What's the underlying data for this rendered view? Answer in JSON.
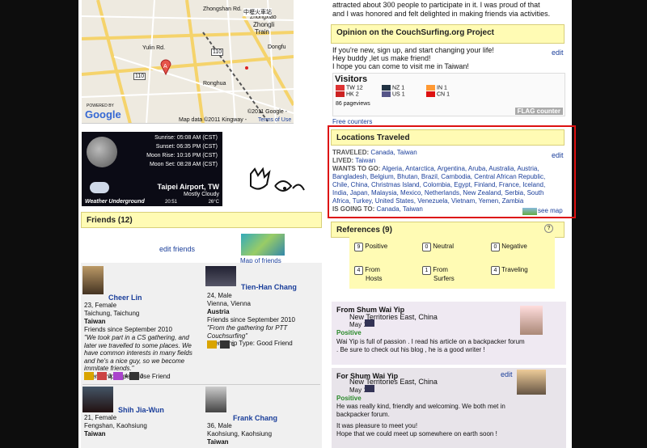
{
  "map": {
    "labels": [
      "Zhongshan Rd.",
      "Zhongxiao",
      "Zhongli",
      "Train",
      "Yulin Rd.",
      "110",
      "110",
      "Ronghua",
      "Dongfu",
      "Kingway"
    ],
    "poster_cn": "中壢火車站",
    "marker": "A",
    "brand": "Google",
    "powered_by": "POWERED BY",
    "copyright": "©2011 Google -",
    "map_data": "Map data ©2011 Kingway -",
    "terms": "Terms of Use"
  },
  "intro": {
    "line1": "attracted about 300 people to participate in it. I was proud of that",
    "line2": "and I was honored and felt delighted in making friends via activities."
  },
  "opinion": {
    "title": "Opinion on the CouchSurfing.org Project",
    "text1": "If you're new, sign up, and start changing your life!",
    "text2": "Hey buddy ,let us make friend!",
    "text3": "I hope you can come to visit me in Taiwan!",
    "edit": "edit"
  },
  "visitors": {
    "title": "Visitors",
    "rows": [
      {
        "code": "TW",
        "count": "12"
      },
      {
        "code": "HK",
        "count": "2"
      },
      {
        "code": "NZ",
        "count": "1"
      },
      {
        "code": "US",
        "count": "1"
      },
      {
        "code": "IN",
        "count": "1"
      },
      {
        "code": "CN",
        "count": "1"
      }
    ],
    "pageviews": "86 pageviews",
    "badge": "FLAG counter",
    "free": "Free counters"
  },
  "weather": {
    "sunrise_label": "Sunrise:",
    "sunrise": "05:08 AM (CST)",
    "sunset_label": "Sunset:",
    "sunset": "06:35 PM (CST)",
    "moonrise_label": "Moon Rise:",
    "moonrise": "10:16 PM (CST)",
    "moonset_label": "Moon Set:",
    "moonset": "08:28 AM (CST)",
    "station": "Taipei Airport, TW",
    "condition": "Mostly Cloudy",
    "brand": "Weather Underground",
    "time": "20:51",
    "temp": "26°C"
  },
  "locations": {
    "title": "Locations Traveled",
    "edit": "edit",
    "traveled_label": "TRAVELED:",
    "traveled": "Canada, Taiwan",
    "lived_label": "LIVED:",
    "lived": "Taiwan",
    "wants_label": "WANTS TO GO:",
    "wants": "Algeria, Antarctica, Argentina, Aruba, Australia, Austria, Bangladesh, Belgium, Bhutan, Brazil, Cambodia, Central African Republic, Chile, China, Christmas Island, Colombia, Egypt, Finland, France, Iceland, India, Japan, Malaysia, Mexico, Netherlands, New Zealand, Serbia, South Africa, Turkey, United States, Venezuela, Vietnam, Yemen, Zambia",
    "going_label": "IS GOING TO:",
    "going": "Canada, Taiwan",
    "see_map": "see map"
  },
  "friends": {
    "title": "Friends (12)",
    "edit": "edit friends",
    "map_link": "Map of friends",
    "list": [
      {
        "name": "Cheer Lin",
        "info": "23, Female",
        "city": "Taichung, Taichung",
        "country": "Taiwan",
        "since": "Friends since September 2010",
        "quote": "\"We took part in a CS gathering, and later we travelled to some places. We have common interests in many fields and he's a nice guy, so we become immitate friends.\"",
        "type": "Friendship Type: Close Friend",
        "c1": "3",
        "c2": "4",
        "c3": "3"
      },
      {
        "name": "Tien-Han Chang",
        "info": "24, Male",
        "city": "Vienna, Vienna",
        "country": "Austria",
        "since": "Friends since September 2010",
        "quote": "\"From the gathering for PTT Couchsurfing\"",
        "type": "Friendship Type: Good Friend",
        "c1": "1"
      },
      {
        "name": "Shih Jia-Wun",
        "info": "21, Female",
        "city": "Fengshan, Kaohsiung",
        "country": "Taiwan"
      },
      {
        "name": "Frank Chang",
        "info": "36, Male",
        "city": "Kaohsiung, Kaohsiung",
        "country": "Taiwan"
      }
    ]
  },
  "references": {
    "title": "References (9)",
    "help": "?",
    "stats": [
      {
        "n": "9",
        "label": "Positive"
      },
      {
        "n": "0",
        "label": "Neutral"
      },
      {
        "n": "0",
        "label": "Negative"
      },
      {
        "n": "4",
        "label1": "From",
        "label2": "Hosts"
      },
      {
        "n": "1",
        "label1": "From",
        "label2": "Surfers"
      },
      {
        "n": "4",
        "label": "Traveling"
      }
    ],
    "items": [
      {
        "head": "From Shum Wai Yip",
        "loc": "New Territories East, China",
        "date": "May 15",
        "rating": "Positive",
        "text1": "Wai Yip is full of passion . I read his article on a backpacker forum",
        "text2": ". Be sure to check out his blog , he is a good writer !"
      },
      {
        "head": "For Shum Wai Yip",
        "edit": "edit",
        "loc": "New Territories East, China",
        "date": "May 15",
        "rating": "Positive",
        "text1": "He was really kind, friendly and welcoming. We both met in",
        "text2": "backpacker forum.",
        "text3": "It was pleasure to meet you!",
        "text4": "Hope that we could meet up somewhere on earth soon !"
      }
    ]
  },
  "colors": {
    "accent": "#1a3e9a",
    "highlight": "#d11111",
    "yellow": "#fffbb4"
  }
}
